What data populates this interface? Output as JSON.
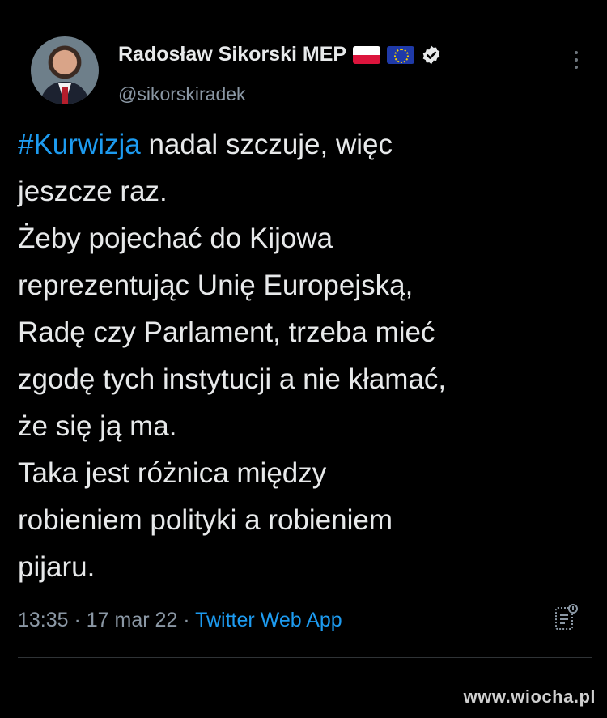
{
  "profile": {
    "display_name": "Radosław Sikorski MEP",
    "handle": "@sikorskiradek",
    "flags": [
      "poland-flag",
      "eu-flag"
    ],
    "verified": true
  },
  "tweet": {
    "hashtag": "#Kurwizja",
    "lines": [
      " nadal szczuje, więc",
      "jeszcze raz.",
      "Żeby pojechać do Kijowa",
      "reprezentując Unię Europejską,",
      "Radę czy Parlament, trzeba mieć",
      "zgodę tych instytucji a nie kłamać,",
      "że się ją ma.",
      "Taka jest różnica między",
      "robieniem polityki a robieniem",
      "pijaru."
    ]
  },
  "meta": {
    "time": "13:35",
    "separator": " · ",
    "date": "17 mar 22",
    "app": "Twitter Web App"
  },
  "watermark": "www.wiocha.pl",
  "colors": {
    "background": "#000000",
    "text": "#e7e9ea",
    "secondary": "#8b98a5",
    "link": "#1d9bf0"
  }
}
